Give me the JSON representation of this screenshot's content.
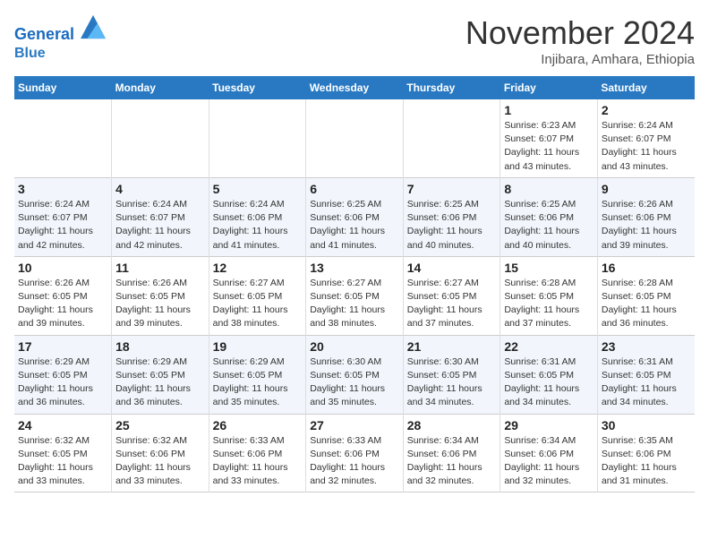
{
  "header": {
    "logo_line1": "General",
    "logo_line2": "Blue",
    "title": "November 2024",
    "subtitle": "Injibara, Amhara, Ethiopia"
  },
  "days_of_week": [
    "Sunday",
    "Monday",
    "Tuesday",
    "Wednesday",
    "Thursday",
    "Friday",
    "Saturday"
  ],
  "weeks": [
    [
      {
        "day": "",
        "info": ""
      },
      {
        "day": "",
        "info": ""
      },
      {
        "day": "",
        "info": ""
      },
      {
        "day": "",
        "info": ""
      },
      {
        "day": "",
        "info": ""
      },
      {
        "day": "1",
        "info": "Sunrise: 6:23 AM\nSunset: 6:07 PM\nDaylight: 11 hours\nand 43 minutes."
      },
      {
        "day": "2",
        "info": "Sunrise: 6:24 AM\nSunset: 6:07 PM\nDaylight: 11 hours\nand 43 minutes."
      }
    ],
    [
      {
        "day": "3",
        "info": "Sunrise: 6:24 AM\nSunset: 6:07 PM\nDaylight: 11 hours\nand 42 minutes."
      },
      {
        "day": "4",
        "info": "Sunrise: 6:24 AM\nSunset: 6:07 PM\nDaylight: 11 hours\nand 42 minutes."
      },
      {
        "day": "5",
        "info": "Sunrise: 6:24 AM\nSunset: 6:06 PM\nDaylight: 11 hours\nand 41 minutes."
      },
      {
        "day": "6",
        "info": "Sunrise: 6:25 AM\nSunset: 6:06 PM\nDaylight: 11 hours\nand 41 minutes."
      },
      {
        "day": "7",
        "info": "Sunrise: 6:25 AM\nSunset: 6:06 PM\nDaylight: 11 hours\nand 40 minutes."
      },
      {
        "day": "8",
        "info": "Sunrise: 6:25 AM\nSunset: 6:06 PM\nDaylight: 11 hours\nand 40 minutes."
      },
      {
        "day": "9",
        "info": "Sunrise: 6:26 AM\nSunset: 6:06 PM\nDaylight: 11 hours\nand 39 minutes."
      }
    ],
    [
      {
        "day": "10",
        "info": "Sunrise: 6:26 AM\nSunset: 6:05 PM\nDaylight: 11 hours\nand 39 minutes."
      },
      {
        "day": "11",
        "info": "Sunrise: 6:26 AM\nSunset: 6:05 PM\nDaylight: 11 hours\nand 39 minutes."
      },
      {
        "day": "12",
        "info": "Sunrise: 6:27 AM\nSunset: 6:05 PM\nDaylight: 11 hours\nand 38 minutes."
      },
      {
        "day": "13",
        "info": "Sunrise: 6:27 AM\nSunset: 6:05 PM\nDaylight: 11 hours\nand 38 minutes."
      },
      {
        "day": "14",
        "info": "Sunrise: 6:27 AM\nSunset: 6:05 PM\nDaylight: 11 hours\nand 37 minutes."
      },
      {
        "day": "15",
        "info": "Sunrise: 6:28 AM\nSunset: 6:05 PM\nDaylight: 11 hours\nand 37 minutes."
      },
      {
        "day": "16",
        "info": "Sunrise: 6:28 AM\nSunset: 6:05 PM\nDaylight: 11 hours\nand 36 minutes."
      }
    ],
    [
      {
        "day": "17",
        "info": "Sunrise: 6:29 AM\nSunset: 6:05 PM\nDaylight: 11 hours\nand 36 minutes."
      },
      {
        "day": "18",
        "info": "Sunrise: 6:29 AM\nSunset: 6:05 PM\nDaylight: 11 hours\nand 36 minutes."
      },
      {
        "day": "19",
        "info": "Sunrise: 6:29 AM\nSunset: 6:05 PM\nDaylight: 11 hours\nand 35 minutes."
      },
      {
        "day": "20",
        "info": "Sunrise: 6:30 AM\nSunset: 6:05 PM\nDaylight: 11 hours\nand 35 minutes."
      },
      {
        "day": "21",
        "info": "Sunrise: 6:30 AM\nSunset: 6:05 PM\nDaylight: 11 hours\nand 34 minutes."
      },
      {
        "day": "22",
        "info": "Sunrise: 6:31 AM\nSunset: 6:05 PM\nDaylight: 11 hours\nand 34 minutes."
      },
      {
        "day": "23",
        "info": "Sunrise: 6:31 AM\nSunset: 6:05 PM\nDaylight: 11 hours\nand 34 minutes."
      }
    ],
    [
      {
        "day": "24",
        "info": "Sunrise: 6:32 AM\nSunset: 6:05 PM\nDaylight: 11 hours\nand 33 minutes."
      },
      {
        "day": "25",
        "info": "Sunrise: 6:32 AM\nSunset: 6:06 PM\nDaylight: 11 hours\nand 33 minutes."
      },
      {
        "day": "26",
        "info": "Sunrise: 6:33 AM\nSunset: 6:06 PM\nDaylight: 11 hours\nand 33 minutes."
      },
      {
        "day": "27",
        "info": "Sunrise: 6:33 AM\nSunset: 6:06 PM\nDaylight: 11 hours\nand 32 minutes."
      },
      {
        "day": "28",
        "info": "Sunrise: 6:34 AM\nSunset: 6:06 PM\nDaylight: 11 hours\nand 32 minutes."
      },
      {
        "day": "29",
        "info": "Sunrise: 6:34 AM\nSunset: 6:06 PM\nDaylight: 11 hours\nand 32 minutes."
      },
      {
        "day": "30",
        "info": "Sunrise: 6:35 AM\nSunset: 6:06 PM\nDaylight: 11 hours\nand 31 minutes."
      }
    ]
  ]
}
